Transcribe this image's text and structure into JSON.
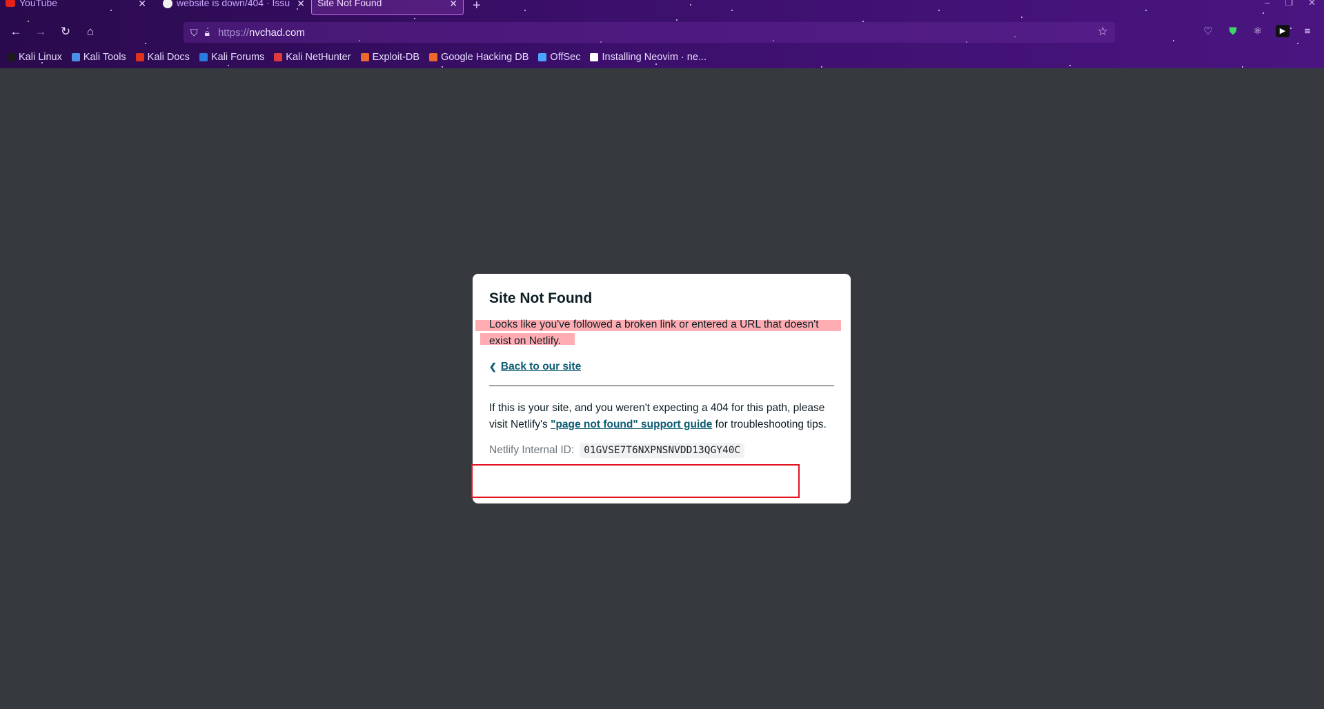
{
  "tabs": [
    {
      "title": "YouTube",
      "close": "✕",
      "active": false
    },
    {
      "title": "website is down/404 · Issu",
      "close": "✕",
      "active": false
    },
    {
      "title": "Site Not Found",
      "close": "✕",
      "active": true
    }
  ],
  "new_tab_label": "+",
  "url": {
    "protocol": "https://",
    "domain": "nvchad.com"
  },
  "bookmarks": [
    {
      "label": "Kali Linux",
      "color": "#1a1a1a"
    },
    {
      "label": "Kali Tools",
      "color": "#4d8fe8"
    },
    {
      "label": "Kali Docs",
      "color": "#e0301e"
    },
    {
      "label": "Kali Forums",
      "color": "#2a7be0"
    },
    {
      "label": "Kali NetHunter",
      "color": "#e03a3a"
    },
    {
      "label": "Exploit-DB",
      "color": "#f0672d"
    },
    {
      "label": "Google Hacking DB",
      "color": "#f0672d"
    },
    {
      "label": "OffSec",
      "color": "#4aa3ff"
    },
    {
      "label": "Installing Neovim · ne...",
      "color": "#ffffff"
    }
  ],
  "card": {
    "title": "Site Not Found",
    "description": "Looks like you've followed a broken link or entered a URL that doesn't exist on Netlify.",
    "back_link": "Back to our site",
    "help_prefix": "If this is your site, and you weren't expecting a 404 for this path, please visit Netlify's ",
    "help_link": "\"page not found\" support guide",
    "help_suffix": " for troubleshooting tips.",
    "internal_id_label": "Netlify Internal ID:",
    "internal_id": "01GVSE7T6NXPNSNVDD13QGY40C"
  },
  "colors": {
    "page_bg": "#36393e",
    "link": "#0c5b73",
    "highlight": "#ffadb3",
    "annotation_box": "#e0131f"
  }
}
